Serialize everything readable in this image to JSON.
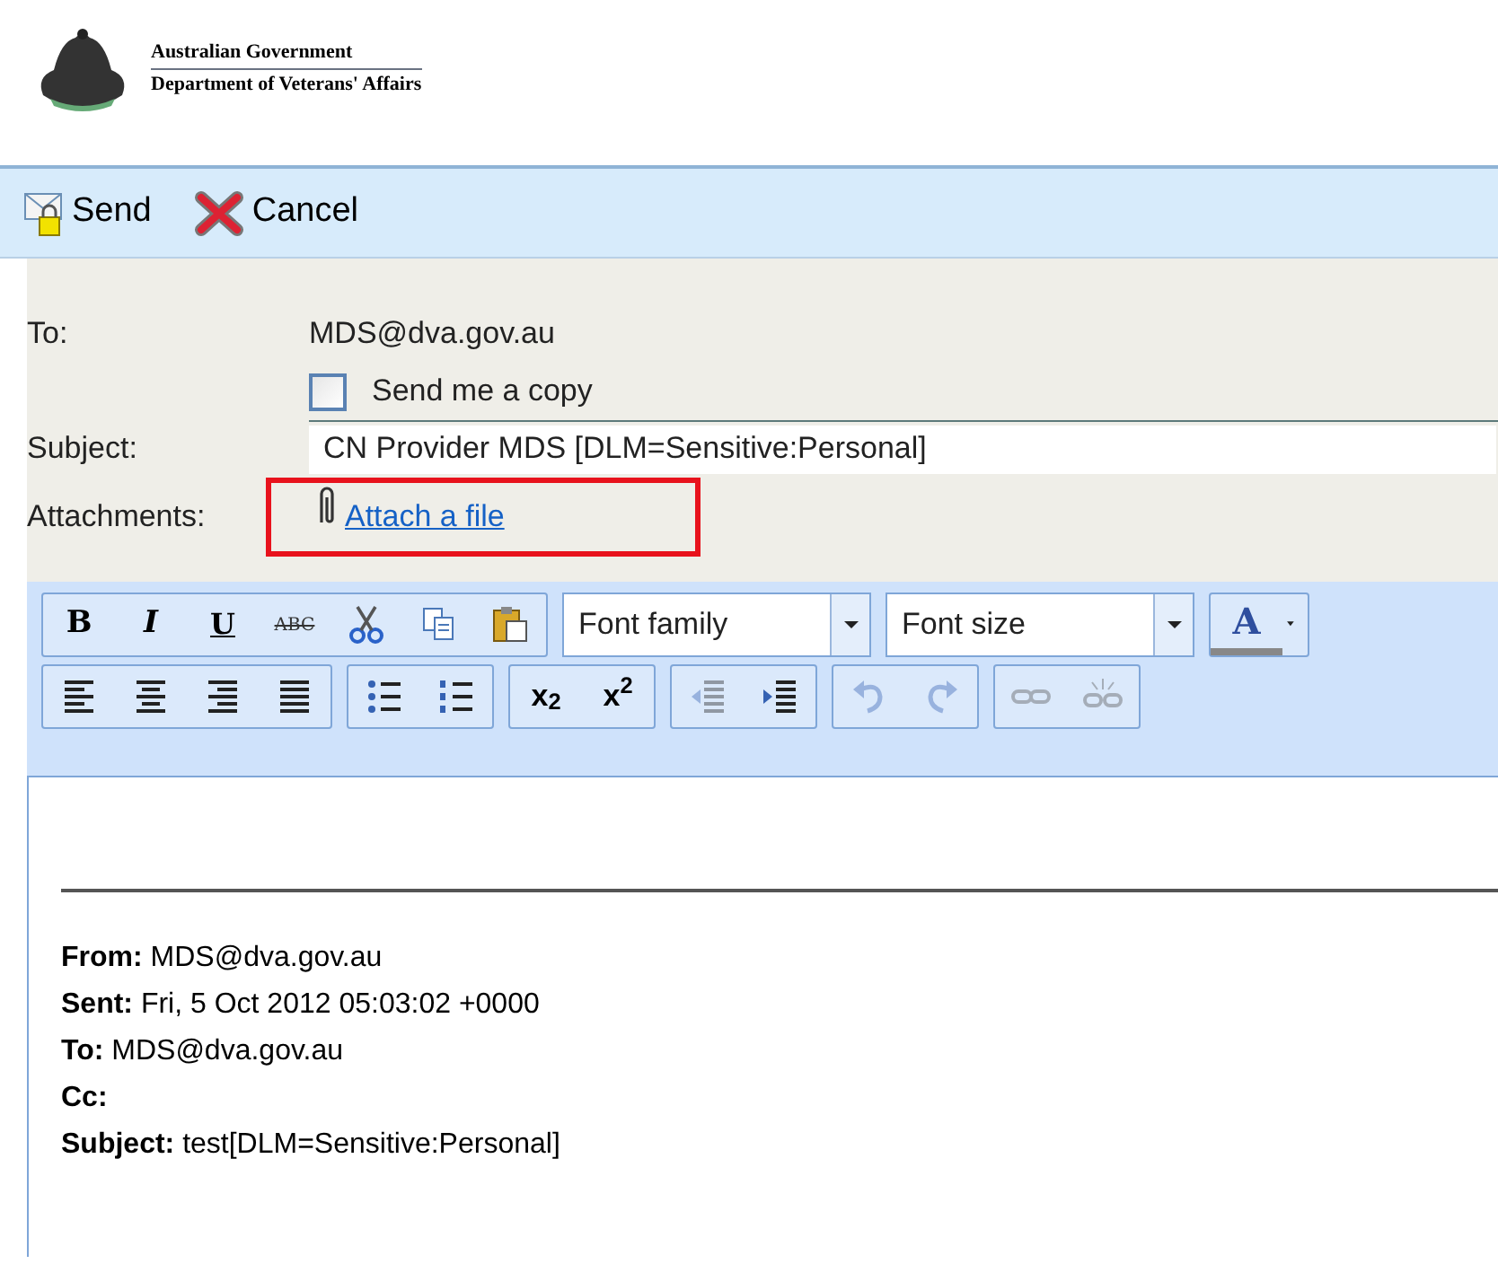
{
  "header": {
    "title": "Australian Government",
    "subtitle": "Department of Veterans' Affairs"
  },
  "actions": [
    {
      "kind": "send",
      "label": "Send"
    },
    {
      "kind": "cancel",
      "label": "Cancel"
    }
  ],
  "form": {
    "to_label": "To:",
    "to_value": "MDS@dva.gov.au",
    "copy": {
      "label": "Send me a copy",
      "checked": false
    },
    "subject_label": "Subject:",
    "subject_value": "CN Provider MDS [DLM=Sensitive:Personal]",
    "attachments_label": "Attachments:",
    "attach_link": "Attach a file",
    "highlighted": true
  },
  "editor_toolbar": [
    [
      {
        "buttons": [
          {
            "kind": "bold",
            "label": "B",
            "disabled": false
          },
          {
            "kind": "italic",
            "label": "I",
            "disabled": false
          },
          {
            "kind": "underline",
            "label": "U",
            "disabled": false
          },
          {
            "kind": "strike",
            "label": "ABC",
            "disabled": false
          },
          {
            "kind": "cut",
            "disabled": false
          },
          {
            "kind": "copy",
            "disabled": false
          },
          {
            "kind": "paste",
            "disabled": false
          }
        ]
      },
      {
        "dropdown": "Font family"
      },
      {
        "dropdown": "Font size"
      },
      {
        "buttons": [
          {
            "kind": "color",
            "label": "A",
            "disabled": false
          },
          {
            "kind": "caret",
            "disabled": false
          }
        ]
      }
    ],
    [
      {
        "buttons": [
          {
            "kind": "align_left",
            "disabled": false
          },
          {
            "kind": "align_center",
            "disabled": false
          },
          {
            "kind": "align_right",
            "disabled": false
          },
          {
            "kind": "justify",
            "disabled": false
          }
        ]
      },
      {
        "buttons": [
          {
            "kind": "bullets",
            "disabled": false
          },
          {
            "kind": "numbers",
            "disabled": false
          }
        ]
      },
      {
        "buttons": [
          {
            "kind": "subscript",
            "label": "x$_{2}$",
            "disabled": false
          },
          {
            "kind": "superscript",
            "label": "x$^{2}$",
            "disabled": false
          }
        ]
      },
      {
        "buttons": [
          {
            "kind": "outdent",
            "disabled": true
          },
          {
            "kind": "indent",
            "disabled": false
          }
        ]
      },
      {
        "buttons": [
          {
            "kind": "undo",
            "disabled": true
          },
          {
            "kind": "redo",
            "disabled": true
          }
        ]
      },
      {
        "buttons": [
          {
            "kind": "link",
            "disabled": true
          },
          {
            "kind": "unlink",
            "disabled": true
          }
        ]
      }
    ]
  ],
  "message_lines": [
    "**From:** MDS@dva.gov.au",
    "**Sent:** Fri, 5 Oct 2012 05:03:02 +0000",
    "**To:** MDS@dva.gov.au",
    "**Cc:**",
    "**Subject:** test[DLM=Sensitive:Personal]"
  ]
}
